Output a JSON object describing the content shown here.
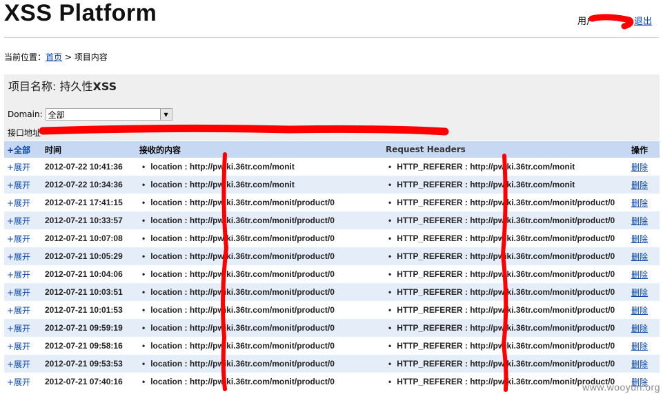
{
  "header": {
    "title": "XSS Platform",
    "user_label": "用户",
    "logout_label": "退出"
  },
  "breadcrumb": {
    "prefix": "当前位置：",
    "home": "首页",
    "sep": " > ",
    "current": "项目内容"
  },
  "project": {
    "name_label": "项目名称: ",
    "name_cn": "持久性",
    "name_xss": "XSS",
    "domain_label": "Domain:",
    "domain_selected": "全部",
    "api_label": "接口地址"
  },
  "table": {
    "headers": {
      "expand_all": "+全部",
      "time": "时间",
      "content": "接收的内容",
      "request_headers": "Request Headers",
      "action": "操作"
    },
    "expand_label": "+展开",
    "delete_label": "删除",
    "rows": [
      {
        "time": "2012-07-22 10:41:36",
        "content": "location : http://pwiki.36tr.com/monit",
        "headers": "HTTP_REFERER : http://pwiki.36tr.com/monit"
      },
      {
        "time": "2012-07-22 10:34:36",
        "content": "location : http://pwiki.36tr.com/monit",
        "headers": "HTTP_REFERER : http://pwiki.36tr.com/monit"
      },
      {
        "time": "2012-07-21 17:41:15",
        "content": "location : http://pwiki.36tr.com/monit/product/0",
        "headers": "HTTP_REFERER : http://pwiki.36tr.com/monit/product/0"
      },
      {
        "time": "2012-07-21 10:33:57",
        "content": "location : http://pwiki.36tr.com/monit/product/0",
        "headers": "HTTP_REFERER : http://pwiki.36tr.com/monit/product/0"
      },
      {
        "time": "2012-07-21 10:07:08",
        "content": "location : http://pwiki.36tr.com/monit/product/0",
        "headers": "HTTP_REFERER : http://pwiki.36tr.com/monit/product/0"
      },
      {
        "time": "2012-07-21 10:05:29",
        "content": "location : http://pwiki.36tr.com/monit/product/0",
        "headers": "HTTP_REFERER : http://pwiki.36tr.com/monit/product/0"
      },
      {
        "time": "2012-07-21 10:04:06",
        "content": "location : http://pwiki.36tr.com/monit/product/0",
        "headers": "HTTP_REFERER : http://pwiki.36tr.com/monit/product/0"
      },
      {
        "time": "2012-07-21 10:03:51",
        "content": "location : http://pwiki.36tr.com/monit/product/0",
        "headers": "HTTP_REFERER : http://pwiki.36tr.com/monit/product/0"
      },
      {
        "time": "2012-07-21 10:01:53",
        "content": "location : http://pwiki.36tr.com/monit/product/0",
        "headers": "HTTP_REFERER : http://pwiki.36tr.com/monit/product/0"
      },
      {
        "time": "2012-07-21 09:59:19",
        "content": "location : http://pwiki.36tr.com/monit/product/0",
        "headers": "HTTP_REFERER : http://pwiki.36tr.com/monit/product/0"
      },
      {
        "time": "2012-07-21 09:58:16",
        "content": "location : http://pwiki.36tr.com/monit/product/0",
        "headers": "HTTP_REFERER : http://pwiki.36tr.com/monit/product/0"
      },
      {
        "time": "2012-07-21 09:53:53",
        "content": "location : http://pwiki.36tr.com/monit/product/0",
        "headers": "HTTP_REFERER : http://pwiki.36tr.com/monit/product/0"
      },
      {
        "time": "2012-07-21 07:40:16",
        "content": "location : http://pwiki.36tr.com/monit/product/0",
        "headers": "HTTP_REFERER : http://pwiki.36tr.com/monit/product/0"
      }
    ]
  },
  "watermark": "www.wooyun.org",
  "colors": {
    "header_row": "#c6d8f2",
    "stripe": "#e5edf8",
    "link": "#0645ad",
    "redaction": "#ff0000"
  }
}
